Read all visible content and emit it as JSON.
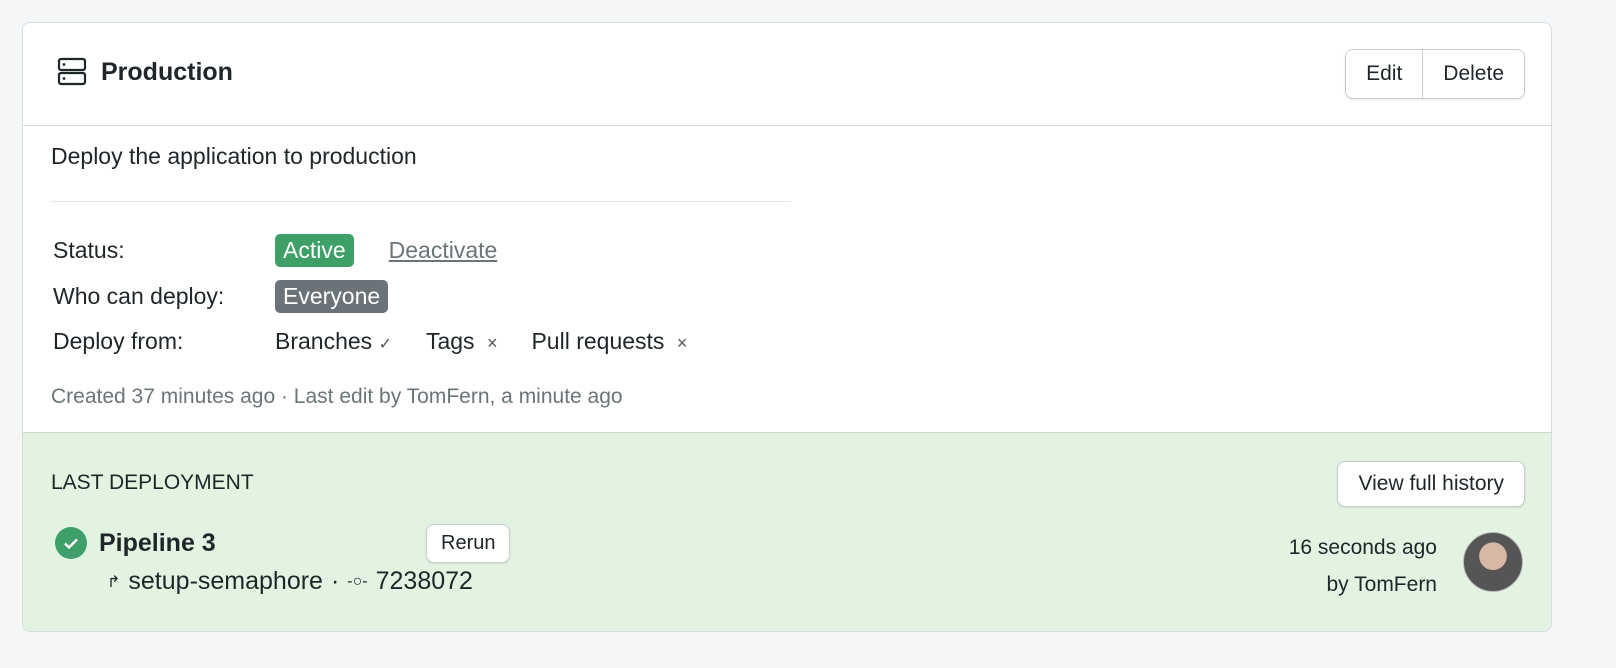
{
  "header": {
    "title": "Production",
    "icon": "server-icon",
    "edit_label": "Edit",
    "delete_label": "Delete"
  },
  "description": "Deploy the application to production",
  "details": {
    "status_label": "Status:",
    "status_value": "Active",
    "status_color": "#3ea066",
    "deactivate_label": "Deactivate",
    "who_label": "Who can deploy:",
    "who_value": "Everyone",
    "who_color": "#6b7378",
    "from_label": "Deploy from:",
    "from_items": [
      {
        "label": "Branches",
        "mark": "✓"
      },
      {
        "label": "Tags",
        "mark": "×"
      },
      {
        "label": "Pull requests",
        "mark": "×"
      }
    ]
  },
  "meta": "Created 37 minutes ago · Last edit by TomFern, a minute ago",
  "last_deployment": {
    "heading": "LAST DEPLOYMENT",
    "history_label": "View full history",
    "pipeline": "Pipeline 3",
    "rerun_label": "Rerun",
    "branch": "setup-semaphore",
    "sep": "·",
    "commit": "7238072",
    "time": "16 seconds ago",
    "by": "by TomFern",
    "status_color": "#3e9f6a"
  }
}
